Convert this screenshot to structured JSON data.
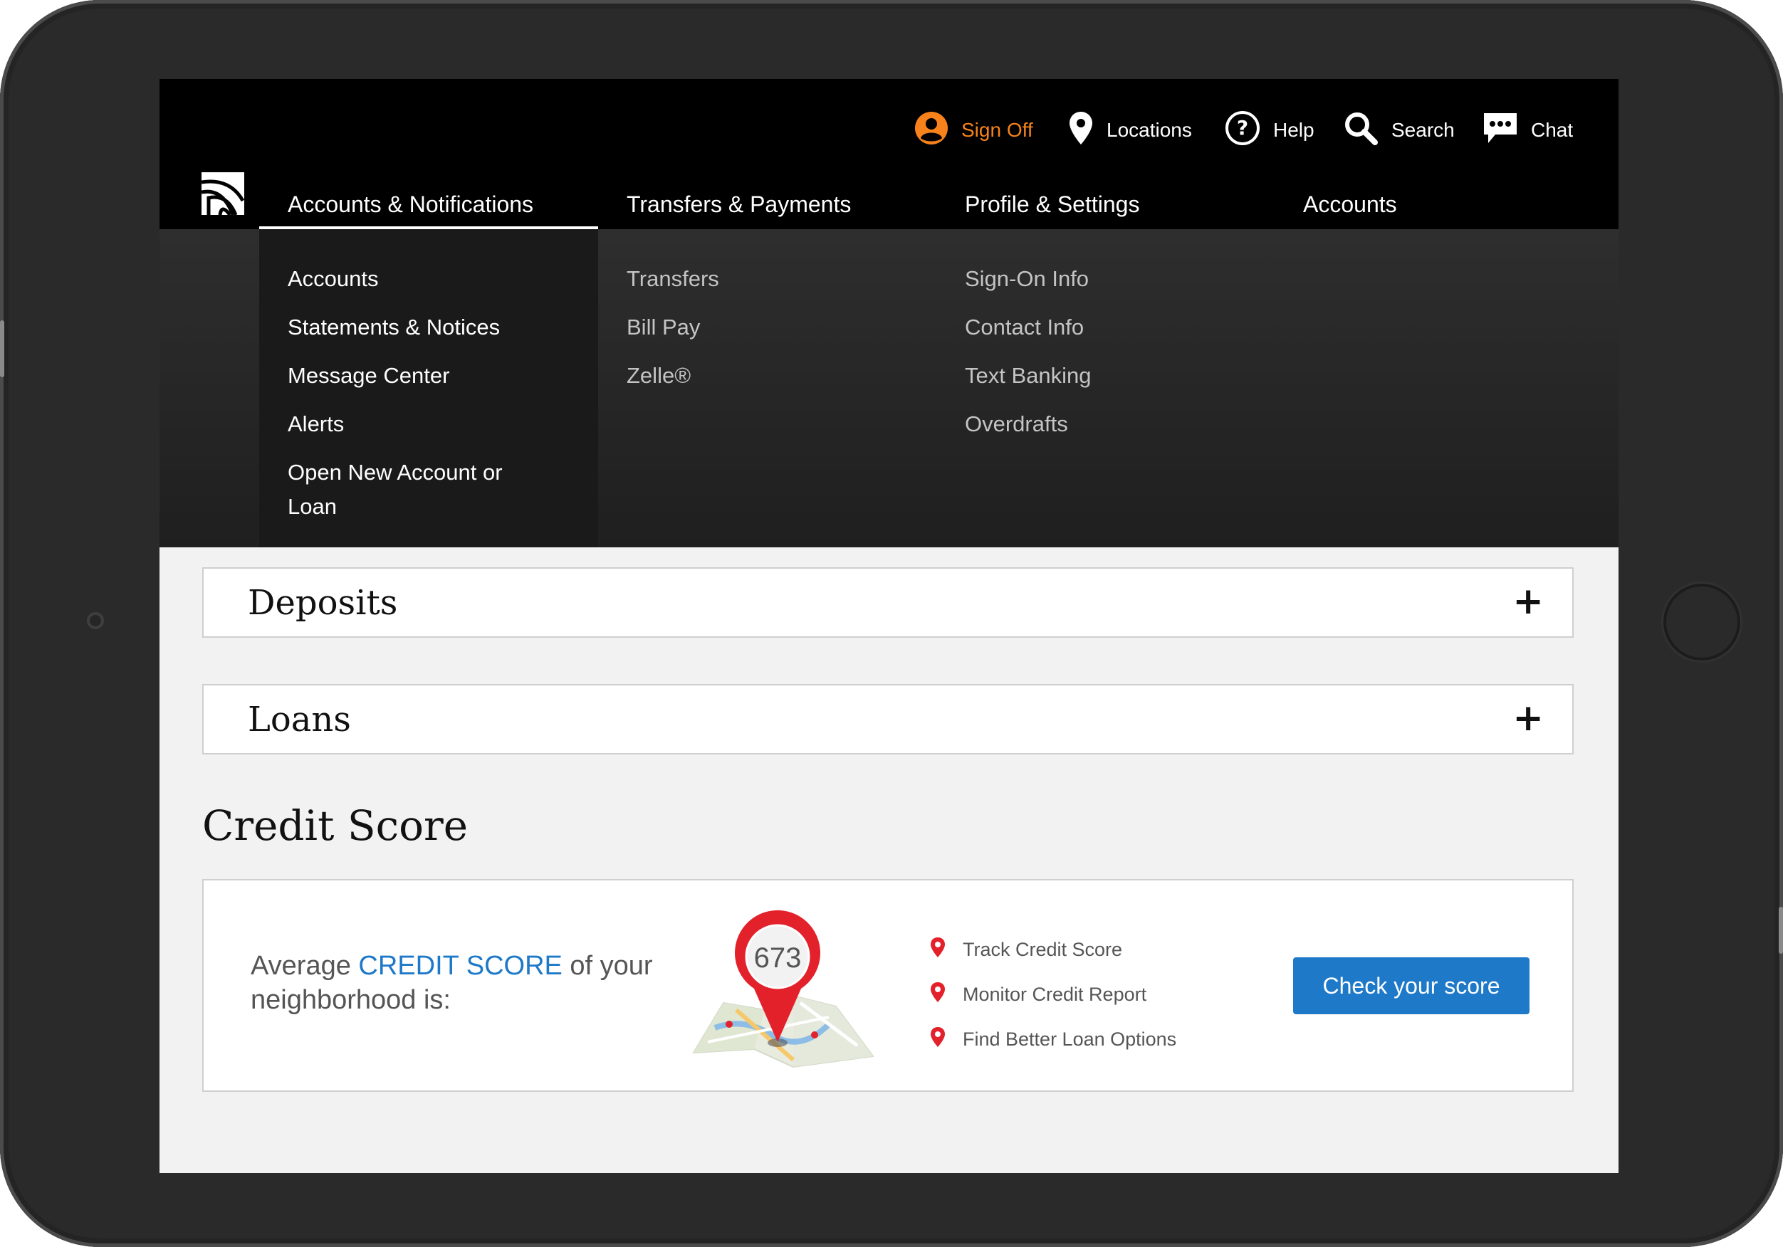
{
  "colors": {
    "accent_orange": "#f7821b",
    "link_blue": "#1e79c8",
    "pin_red": "#e3212b",
    "header_black": "#000000"
  },
  "utility_nav": {
    "sign_off": "Sign Off",
    "locations": "Locations",
    "help": "Help",
    "search": "Search",
    "chat": "Chat"
  },
  "main_nav": {
    "tabs": [
      {
        "label": "Accounts & Notifications",
        "active": true
      },
      {
        "label": "Transfers & Payments"
      },
      {
        "label": "Profile & Settings"
      },
      {
        "label": "Accounts"
      }
    ]
  },
  "mega_menu": {
    "col1": [
      "Accounts",
      "Statements & Notices",
      "Message Center",
      "Alerts",
      "Open New Account or Loan"
    ],
    "col2": [
      "Transfers",
      "Bill Pay",
      "Zelle®"
    ],
    "col3": [
      "Sign-On Info",
      "Contact Info",
      "Text Banking",
      "Overdrafts"
    ]
  },
  "accordions": [
    {
      "title": "Deposits",
      "toggle": "+"
    },
    {
      "title": "Loans",
      "toggle": "+"
    }
  ],
  "credit_score": {
    "section_title": "Credit Score",
    "avg_prefix": "Average ",
    "avg_highlight": "CREDIT SCORE",
    "avg_suffix": " of your neighborhood is:",
    "score": "673",
    "features": [
      "Track Credit Score",
      "Monitor Credit Report",
      "Find Better Loan Options"
    ],
    "cta": "Check your score"
  },
  "icons": [
    "user-icon",
    "location-pin-icon",
    "help-icon",
    "search-icon",
    "chat-icon",
    "brand-logo"
  ]
}
